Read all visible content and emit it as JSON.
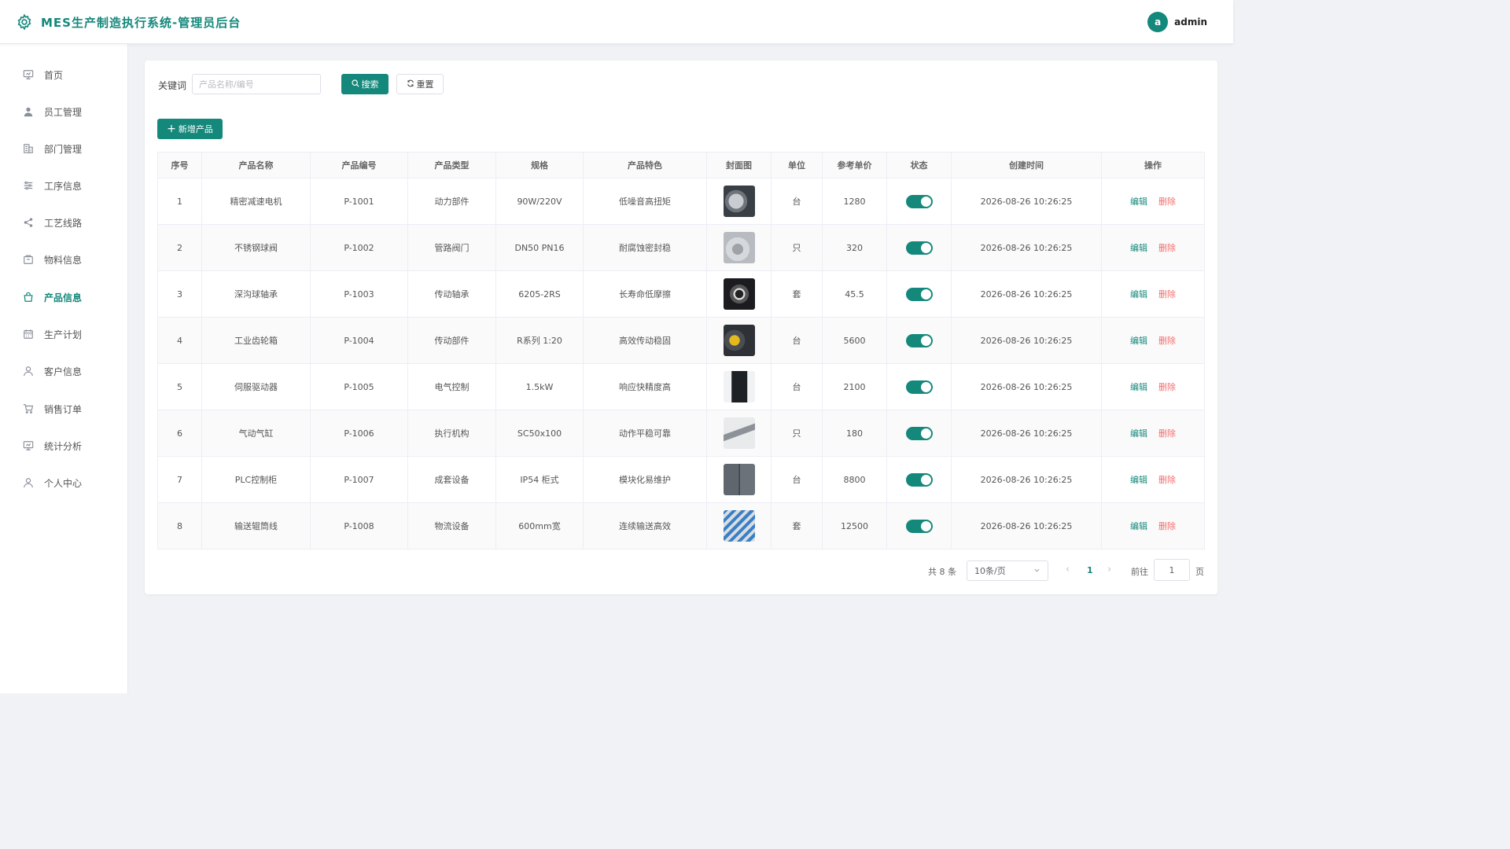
{
  "app": {
    "title": "MES生产制造执行系统-管理员后台"
  },
  "user": {
    "avatar_letter": "a",
    "name": "admin"
  },
  "sidebar": {
    "items": [
      {
        "label": "首页",
        "icon": "monitor-icon"
      },
      {
        "label": "员工管理",
        "icon": "user-icon"
      },
      {
        "label": "部门管理",
        "icon": "building-icon"
      },
      {
        "label": "工序信息",
        "icon": "sliders-icon"
      },
      {
        "label": "工艺线路",
        "icon": "share-icon"
      },
      {
        "label": "物料信息",
        "icon": "box-icon"
      },
      {
        "label": "产品信息",
        "icon": "bag-icon",
        "active": true
      },
      {
        "label": "生产计划",
        "icon": "calendar-icon"
      },
      {
        "label": "客户信息",
        "icon": "user-outline-icon"
      },
      {
        "label": "销售订单",
        "icon": "cart-icon"
      },
      {
        "label": "统计分析",
        "icon": "monitor-icon"
      },
      {
        "label": "个人中心",
        "icon": "user-outline-icon"
      }
    ]
  },
  "search": {
    "label": "关键词",
    "placeholder": "产品名称/编号",
    "value": "",
    "search_button": "搜索",
    "reset_button": "重置"
  },
  "toolbar": {
    "add_button": "新增产品"
  },
  "table": {
    "headers": [
      "序号",
      "产品名称",
      "产品编号",
      "产品类型",
      "规格",
      "产品特色",
      "封面图",
      "单位",
      "参考单价",
      "状态",
      "创建时间",
      "操作"
    ],
    "edit_label": "编辑",
    "delete_label": "删除",
    "rows": [
      {
        "no": "1",
        "name": "精密减速电机",
        "code": "P-1001",
        "type": "动力部件",
        "spec": "90W/220V",
        "feature": "低噪音高扭矩",
        "unit": "台",
        "price": "1280",
        "status": true,
        "created": "2026-08-26 10:26:25"
      },
      {
        "no": "2",
        "name": "不锈钢球阀",
        "code": "P-1002",
        "type": "管路阀门",
        "spec": "DN50 PN16",
        "feature": "耐腐蚀密封稳",
        "unit": "只",
        "price": "320",
        "status": true,
        "created": "2026-08-26 10:26:25"
      },
      {
        "no": "3",
        "name": "深沟球轴承",
        "code": "P-1003",
        "type": "传动轴承",
        "spec": "6205-2RS",
        "feature": "长寿命低摩擦",
        "unit": "套",
        "price": "45.5",
        "status": true,
        "created": "2026-08-26 10:26:25"
      },
      {
        "no": "4",
        "name": "工业齿轮箱",
        "code": "P-1004",
        "type": "传动部件",
        "spec": "R系列 1:20",
        "feature": "高效传动稳固",
        "unit": "台",
        "price": "5600",
        "status": true,
        "created": "2026-08-26 10:26:25"
      },
      {
        "no": "5",
        "name": "伺服驱动器",
        "code": "P-1005",
        "type": "电气控制",
        "spec": "1.5kW",
        "feature": "响应快精度高",
        "unit": "台",
        "price": "2100",
        "status": true,
        "created": "2026-08-26 10:26:25"
      },
      {
        "no": "6",
        "name": "气动气缸",
        "code": "P-1006",
        "type": "执行机构",
        "spec": "SC50x100",
        "feature": "动作平稳可靠",
        "unit": "只",
        "price": "180",
        "status": true,
        "created": "2026-08-26 10:26:25"
      },
      {
        "no": "7",
        "name": "PLC控制柜",
        "code": "P-1007",
        "type": "成套设备",
        "spec": "IP54 柜式",
        "feature": "模块化易维护",
        "unit": "台",
        "price": "8800",
        "status": true,
        "created": "2026-08-26 10:26:25"
      },
      {
        "no": "8",
        "name": "输送辊筒线",
        "code": "P-1008",
        "type": "物流设备",
        "spec": "600mm宽",
        "feature": "连续输送高效",
        "unit": "套",
        "price": "12500",
        "status": true,
        "created": "2026-08-26 10:26:25"
      }
    ]
  },
  "pagination": {
    "total_text": "共 8 条",
    "page_size": "10条/页",
    "current_page": "1",
    "goto_label": "前往",
    "goto_value": "1",
    "page_suffix": "页"
  },
  "colors": {
    "accent": "#14887b",
    "danger": "#f56c6c"
  }
}
